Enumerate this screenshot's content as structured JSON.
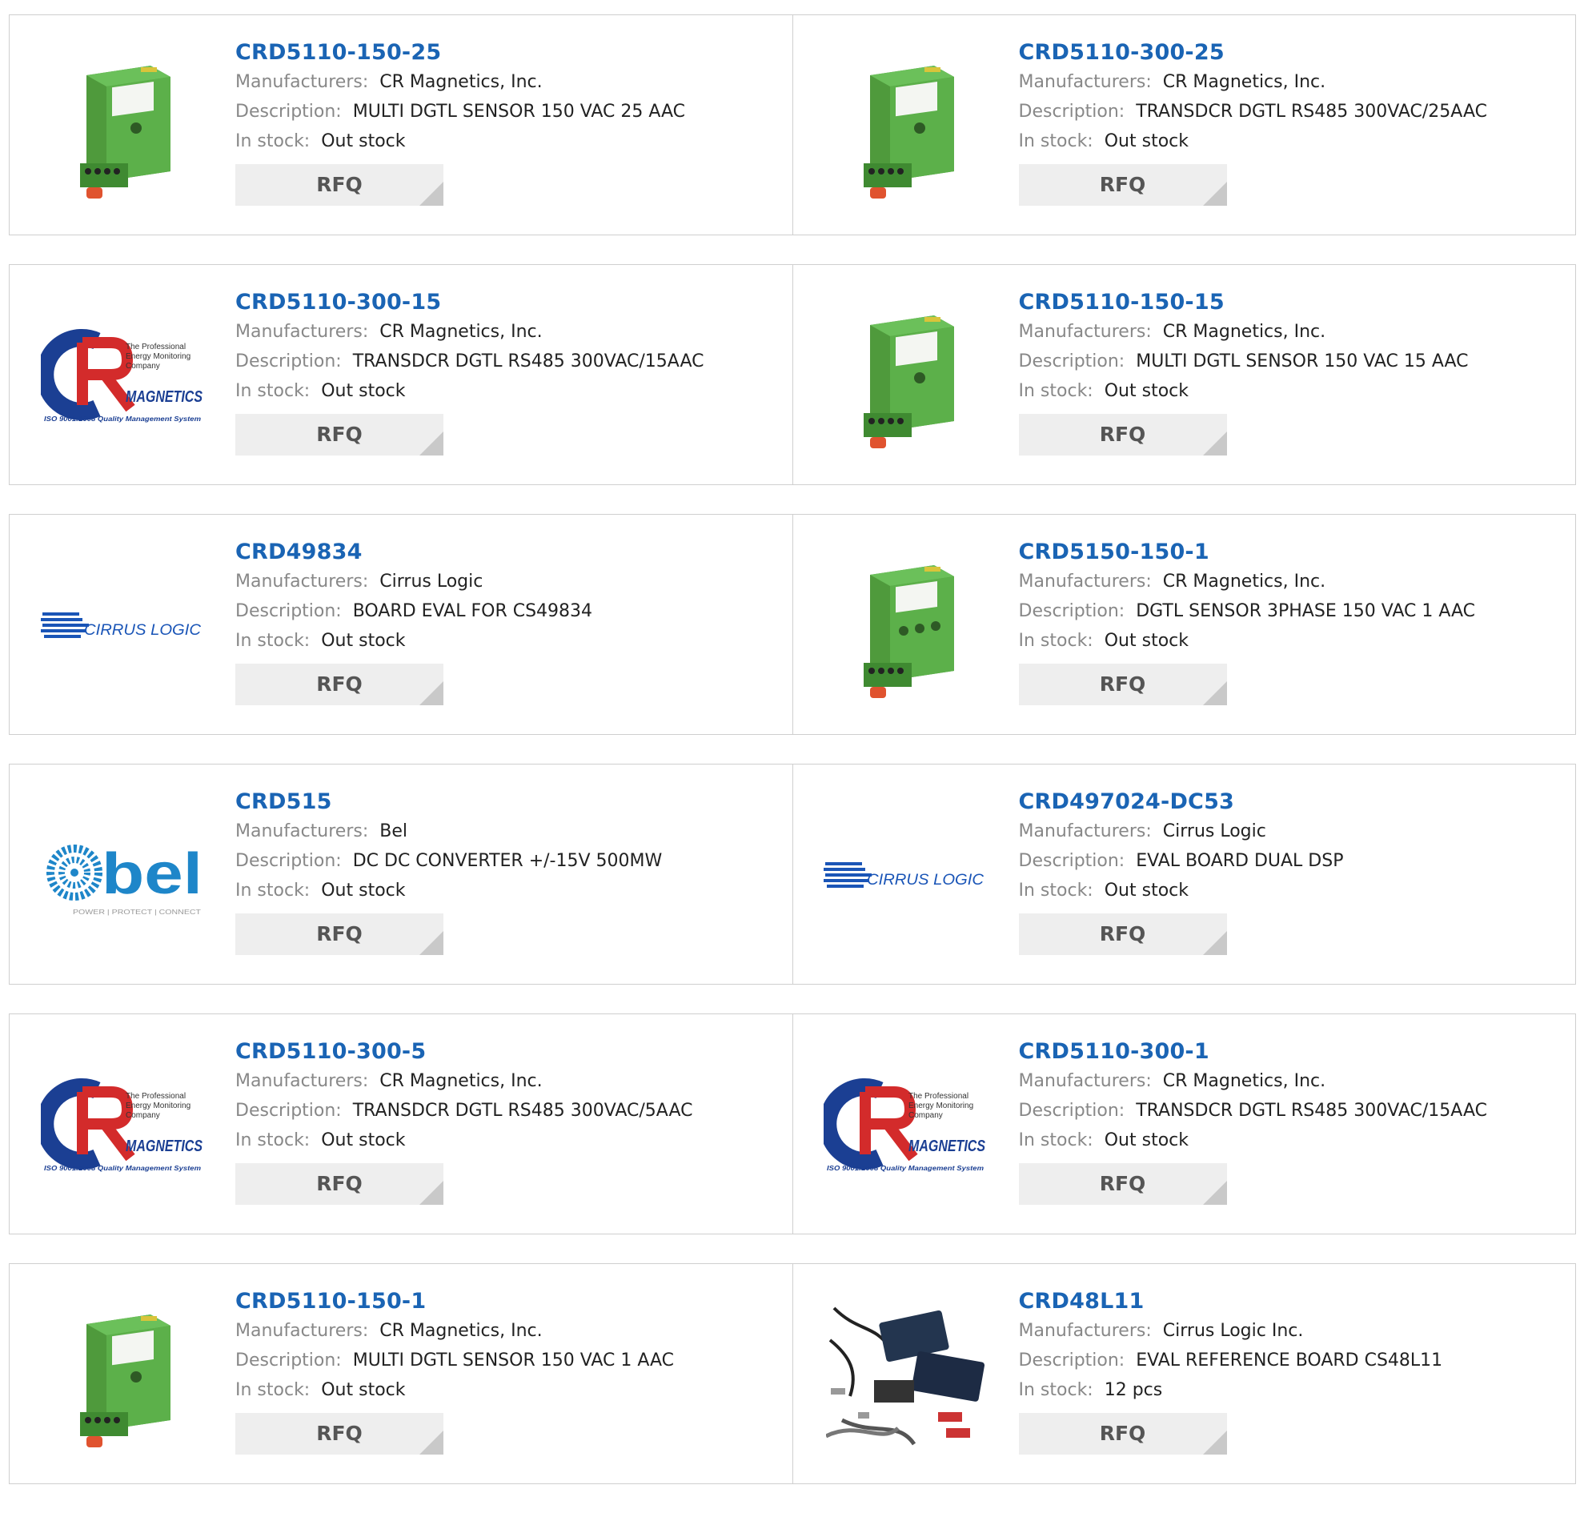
{
  "labels": {
    "manufacturers": "Manufacturers:",
    "description": "Description:",
    "in_stock": "In stock:",
    "rfq": "RFQ"
  },
  "logos": {
    "cr_tagline_1": "The Professional",
    "cr_tagline_2": "Energy Monitoring",
    "cr_tagline_3": "Company",
    "cr_word": "MAGNETICS",
    "cr_iso": "ISO 9001:2008 Quality Management System",
    "cirrus": "CIRRUS LOGIC",
    "bel": "bel",
    "bel_tagline": "POWER | PROTECT | CONNECT"
  },
  "colors": {
    "link": "#1a64b4",
    "card_border": "#cfcfcf",
    "rfq_bg": "#eeeeee",
    "label": "#888888"
  },
  "products": [
    {
      "part": "CRD5110-150-25",
      "manufacturer": "CR Magnetics, Inc.",
      "description": "MULTI DGTL SENSOR 150 VAC 25 AAC",
      "stock": "Out stock",
      "image": "green-sensor-module"
    },
    {
      "part": "CRD5110-300-25",
      "manufacturer": "CR Magnetics, Inc.",
      "description": "TRANSDCR DGTL RS485 300VAC/25AAC",
      "stock": "Out stock",
      "image": "green-sensor-module"
    },
    {
      "part": "CRD5110-300-15",
      "manufacturer": "CR Magnetics, Inc.",
      "description": "TRANSDCR DGTL RS485 300VAC/15AAC",
      "stock": "Out stock",
      "image": "cr-magnetics-logo"
    },
    {
      "part": "CRD5110-150-15",
      "manufacturer": "CR Magnetics, Inc.",
      "description": "MULTI DGTL SENSOR 150 VAC 15 AAC",
      "stock": "Out stock",
      "image": "green-sensor-module"
    },
    {
      "part": "CRD49834",
      "manufacturer": "Cirrus Logic",
      "description": "BOARD EVAL FOR CS49834",
      "stock": "Out stock",
      "image": "cirrus-logic-logo"
    },
    {
      "part": "CRD5150-150-1",
      "manufacturer": "CR Magnetics, Inc.",
      "description": "DGTL SENSOR 3PHASE 150 VAC 1 AAC",
      "stock": "Out stock",
      "image": "green-sensor-module-3phase"
    },
    {
      "part": "CRD515",
      "manufacturer": "Bel",
      "description": "DC DC CONVERTER +/-15V 500MW",
      "stock": "Out stock",
      "image": "bel-logo"
    },
    {
      "part": "CRD497024-DC53",
      "manufacturer": "Cirrus Logic",
      "description": "EVAL BOARD DUAL DSP",
      "stock": "Out stock",
      "image": "cirrus-logic-logo"
    },
    {
      "part": "CRD5110-300-5",
      "manufacturer": "CR Magnetics, Inc.",
      "description": "TRANSDCR DGTL RS485 300VAC/5AAC",
      "stock": "Out stock",
      "image": "cr-magnetics-logo"
    },
    {
      "part": "CRD5110-300-1",
      "manufacturer": "CR Magnetics, Inc.",
      "description": "TRANSDCR DGTL RS485 300VAC/15AAC",
      "stock": "Out stock",
      "image": "cr-magnetics-logo"
    },
    {
      "part": "CRD5110-150-1",
      "manufacturer": "CR Magnetics, Inc.",
      "description": "MULTI DGTL SENSOR 150 VAC 1 AAC",
      "stock": "Out stock",
      "image": "green-sensor-module"
    },
    {
      "part": "CRD48L11",
      "manufacturer": "Cirrus Logic Inc.",
      "description": "EVAL REFERENCE BOARD CS48L11",
      "stock": "12 pcs",
      "image": "eval-board-kit-photo"
    }
  ]
}
